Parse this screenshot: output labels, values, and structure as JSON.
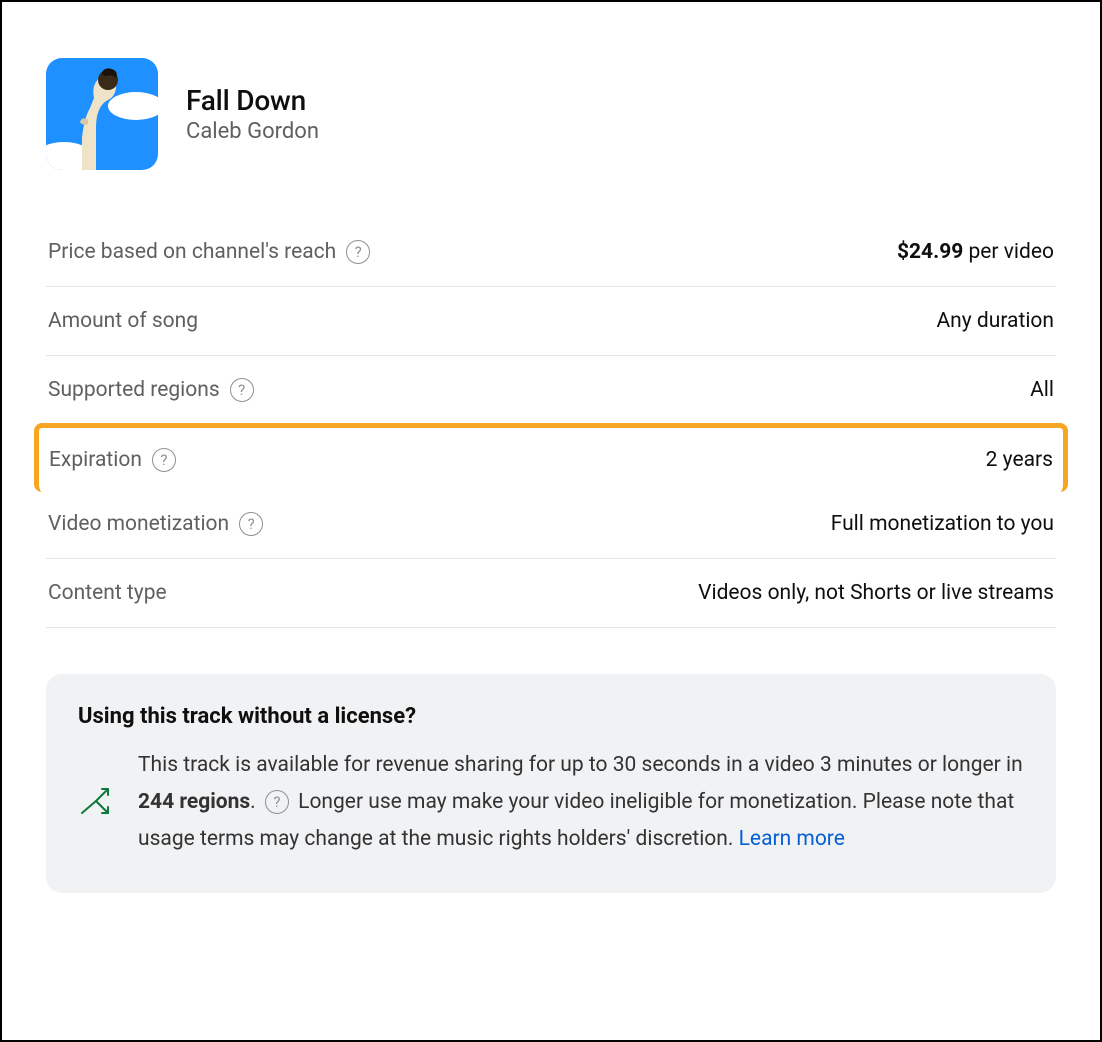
{
  "track": {
    "title": "Fall Down",
    "artist": "Caleb Gordon"
  },
  "rows": {
    "price_label": "Price based on channel's reach",
    "price_amount": "$24.99",
    "price_suffix": " per video",
    "amount_label": "Amount of song",
    "amount_value": "Any duration",
    "regions_label": "Supported regions",
    "regions_value": "All",
    "expiration_label": "Expiration",
    "expiration_value": "2 years",
    "monetization_label": "Video monetization",
    "monetization_value": "Full monetization to you",
    "content_label": "Content type",
    "content_value": "Videos only, not Shorts or live streams"
  },
  "info": {
    "title": "Using this track without a license?",
    "text_1": "This track is available for revenue sharing for up to 30 seconds in a video 3 minutes or longer in ",
    "regions_bold": "244 regions",
    "text_2": ". ",
    "text_3": " Longer use may make your video ineligible for monetization. Please note that usage terms may change at the music rights holders' discretion. ",
    "learn_more": "Learn more"
  },
  "help_glyph": "?"
}
